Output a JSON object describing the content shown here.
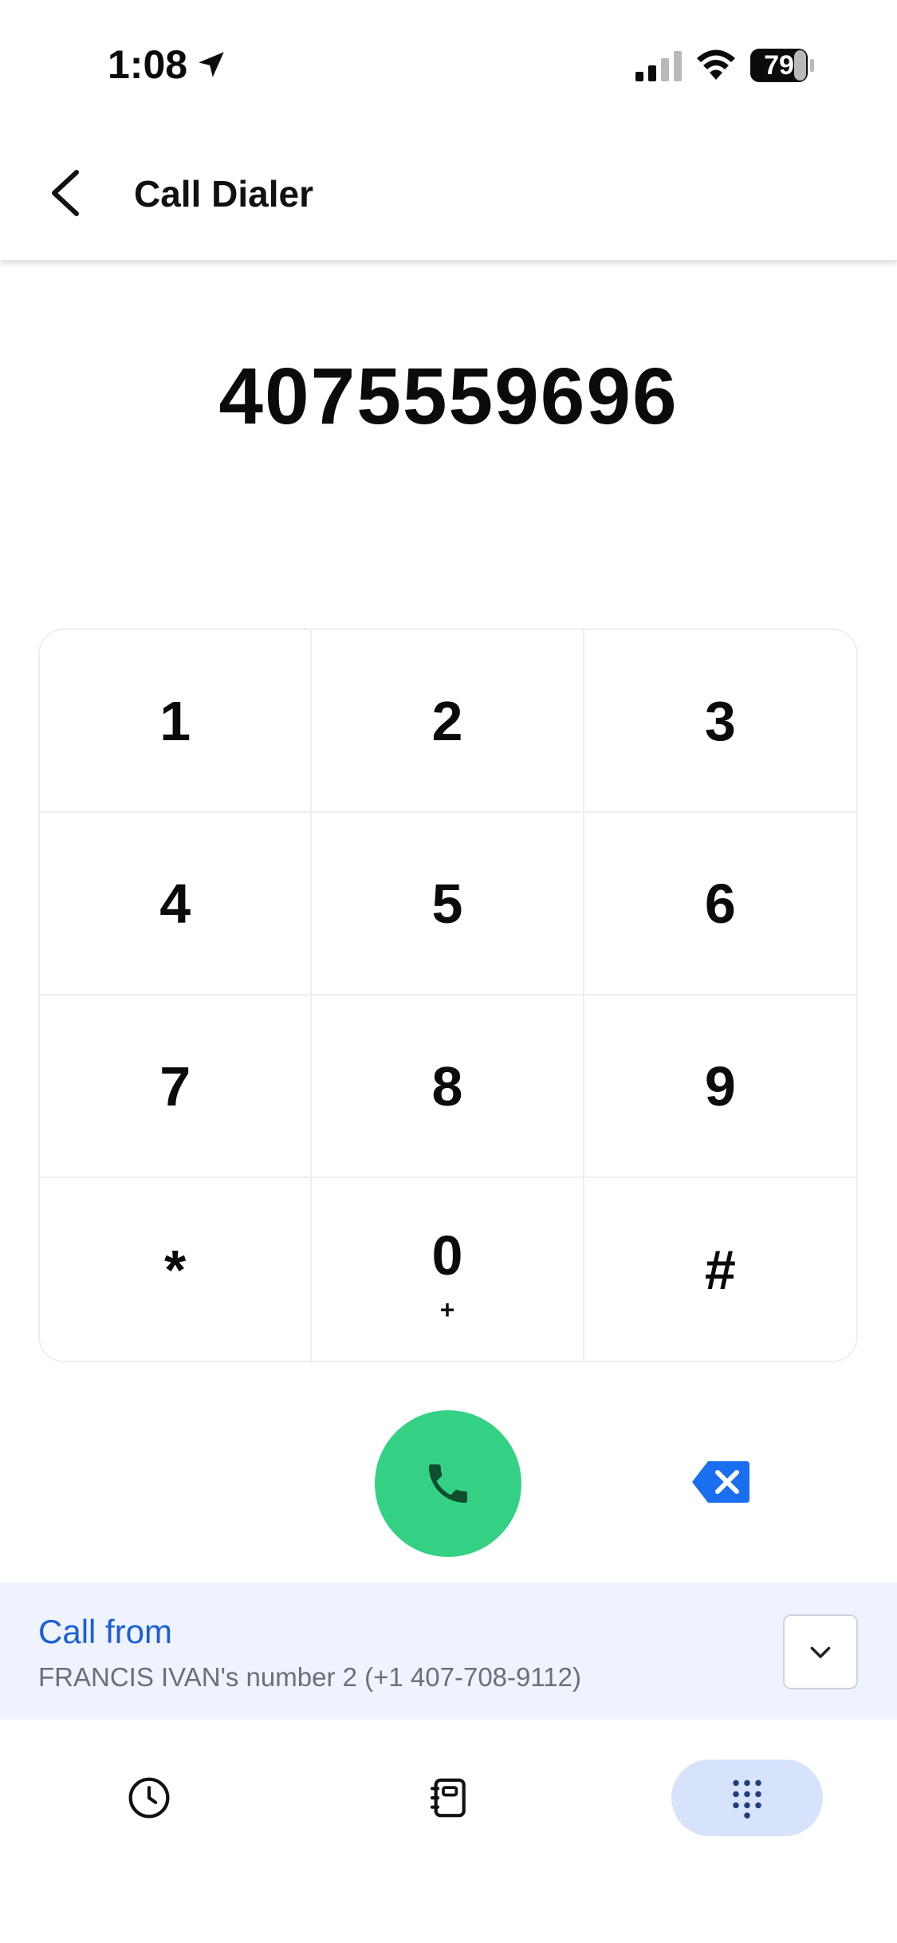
{
  "status_bar": {
    "time": "1:08",
    "battery": "79"
  },
  "header": {
    "title": "Call Dialer"
  },
  "dialer": {
    "number": "4075559696"
  },
  "keypad": {
    "keys": [
      {
        "digit": "1",
        "sub": ""
      },
      {
        "digit": "2",
        "sub": ""
      },
      {
        "digit": "3",
        "sub": ""
      },
      {
        "digit": "4",
        "sub": ""
      },
      {
        "digit": "5",
        "sub": ""
      },
      {
        "digit": "6",
        "sub": ""
      },
      {
        "digit": "7",
        "sub": ""
      },
      {
        "digit": "8",
        "sub": ""
      },
      {
        "digit": "9",
        "sub": ""
      },
      {
        "digit": "*",
        "sub": ""
      },
      {
        "digit": "0",
        "sub": "+"
      },
      {
        "digit": "#",
        "sub": ""
      }
    ]
  },
  "call_from": {
    "label": "Call from",
    "number": "FRANCIS IVAN's number 2 (+1 407-708-9112)"
  },
  "tabs": {
    "active": "keypad",
    "items": [
      "recents-clock-icon",
      "contacts-book-icon",
      "keypad-dots-icon"
    ]
  },
  "colors": {
    "call_green": "#34d184",
    "accent_blue": "#1a5fd8",
    "call_from_bg": "#eef3fd",
    "active_tab_bg": "#d6e3fb"
  }
}
